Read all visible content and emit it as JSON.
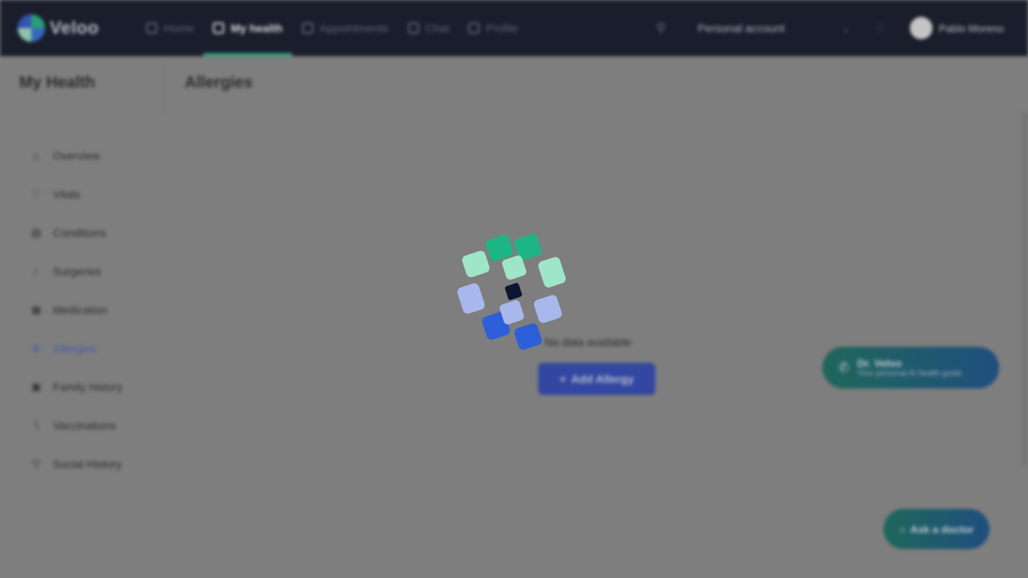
{
  "app": {
    "logo_text": "Veloo"
  },
  "nav": {
    "items": [
      {
        "label": "Home",
        "active": false
      },
      {
        "label": "My health",
        "active": true
      },
      {
        "label": "Appointments",
        "active": false
      },
      {
        "label": "Chat",
        "active": false
      },
      {
        "label": "Profile",
        "active": false
      }
    ],
    "account_label": "Personal account",
    "user_name": "Pablo Moreno"
  },
  "sidebar": {
    "title": "My Health",
    "items": [
      {
        "label": "Overview",
        "icon": "home-icon"
      },
      {
        "label": "Vitals",
        "icon": "heart-icon"
      },
      {
        "label": "Conditions",
        "icon": "clipboard-icon"
      },
      {
        "label": "Surgeries",
        "icon": "scalpel-icon"
      },
      {
        "label": "Medication",
        "icon": "pill-icon"
      },
      {
        "label": "Allergies",
        "icon": "allergy-icon",
        "active": true
      },
      {
        "label": "Family history",
        "icon": "family-icon"
      },
      {
        "label": "Vaccinations",
        "icon": "syringe-icon"
      },
      {
        "label": "Social History",
        "icon": "glass-icon"
      }
    ]
  },
  "main": {
    "title": "Allergies",
    "empty_text": "No data available",
    "add_button": "Add Allergy"
  },
  "promo": {
    "title": "Dr. Veloo",
    "subtitle": "Your personal AI health guide"
  },
  "ask_button": "Ask a doctor",
  "colors": {
    "nav_bg": "#050a1c",
    "accent_green": "#1db584",
    "accent_blue": "#2541b8",
    "spinner_mint": "#9fe6c9",
    "spinner_lilac": "#a9b8ec",
    "spinner_center": "#0d1530"
  }
}
